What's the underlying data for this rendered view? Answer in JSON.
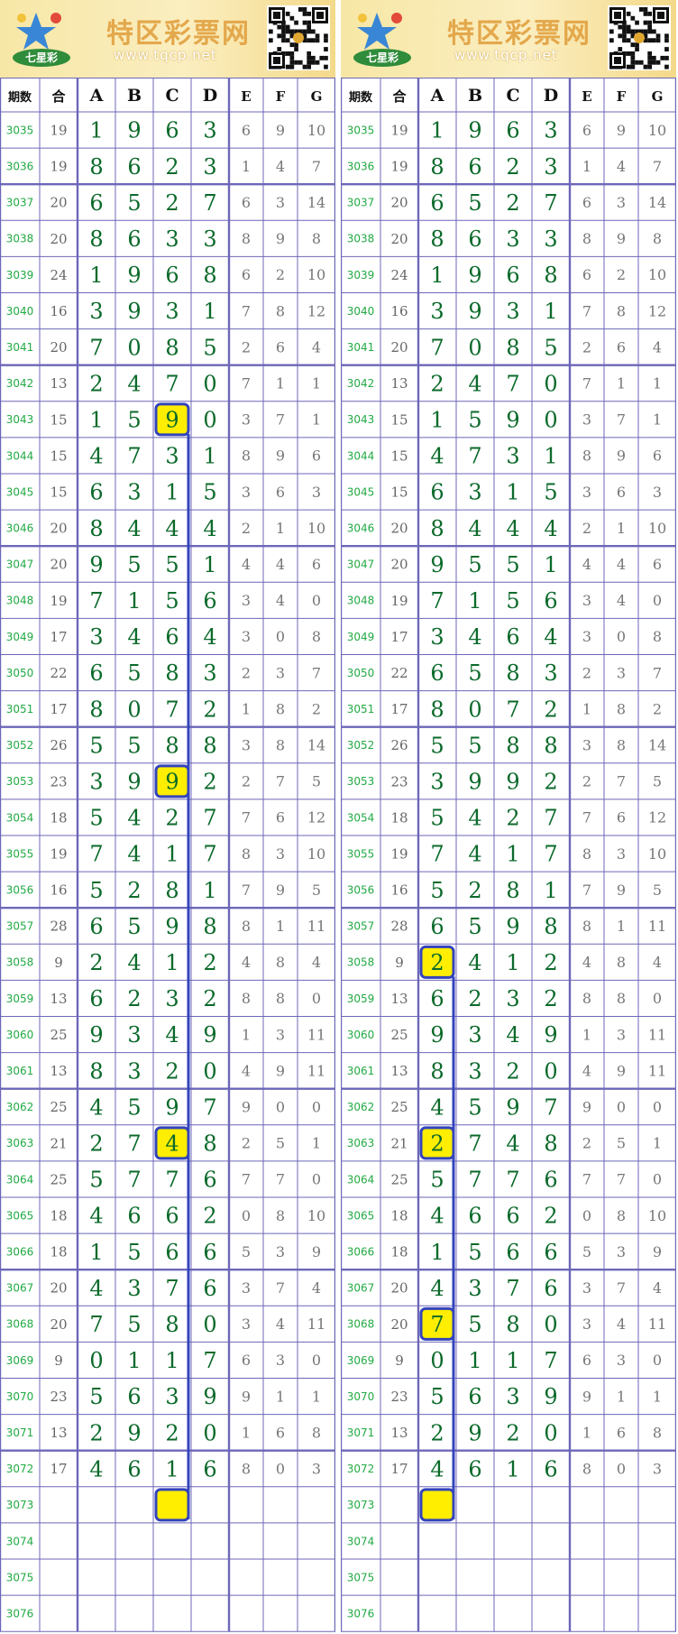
{
  "site": {
    "title": "特区彩票网",
    "url": "www.tqcp.net",
    "logo_text": "七星彩"
  },
  "columns": [
    "期数",
    "合",
    "A",
    "B",
    "C",
    "D",
    "E",
    "F",
    "G"
  ],
  "rows": [
    {
      "issue": "3035",
      "sum": "19",
      "a": "1",
      "b": "9",
      "c": "6",
      "d": "3",
      "e": "6",
      "f": "9",
      "g": "10"
    },
    {
      "issue": "3036",
      "sum": "19",
      "a": "8",
      "b": "6",
      "c": "2",
      "d": "3",
      "e": "1",
      "f": "4",
      "g": "7"
    },
    {
      "issue": "3037",
      "sum": "20",
      "a": "6",
      "b": "5",
      "c": "2",
      "d": "7",
      "e": "6",
      "f": "3",
      "g": "14"
    },
    {
      "issue": "3038",
      "sum": "20",
      "a": "8",
      "b": "6",
      "c": "3",
      "d": "3",
      "e": "8",
      "f": "9",
      "g": "8"
    },
    {
      "issue": "3039",
      "sum": "24",
      "a": "1",
      "b": "9",
      "c": "6",
      "d": "8",
      "e": "6",
      "f": "2",
      "g": "10"
    },
    {
      "issue": "3040",
      "sum": "16",
      "a": "3",
      "b": "9",
      "c": "3",
      "d": "1",
      "e": "7",
      "f": "8",
      "g": "12"
    },
    {
      "issue": "3041",
      "sum": "20",
      "a": "7",
      "b": "0",
      "c": "8",
      "d": "5",
      "e": "2",
      "f": "6",
      "g": "4"
    },
    {
      "issue": "3042",
      "sum": "13",
      "a": "2",
      "b": "4",
      "c": "7",
      "d": "0",
      "e": "7",
      "f": "1",
      "g": "1"
    },
    {
      "issue": "3043",
      "sum": "15",
      "a": "1",
      "b": "5",
      "c": "9",
      "d": "0",
      "e": "3",
      "f": "7",
      "g": "1"
    },
    {
      "issue": "3044",
      "sum": "15",
      "a": "4",
      "b": "7",
      "c": "3",
      "d": "1",
      "e": "8",
      "f": "9",
      "g": "6"
    },
    {
      "issue": "3045",
      "sum": "15",
      "a": "6",
      "b": "3",
      "c": "1",
      "d": "5",
      "e": "3",
      "f": "6",
      "g": "3"
    },
    {
      "issue": "3046",
      "sum": "20",
      "a": "8",
      "b": "4",
      "c": "4",
      "d": "4",
      "e": "2",
      "f": "1",
      "g": "10"
    },
    {
      "issue": "3047",
      "sum": "20",
      "a": "9",
      "b": "5",
      "c": "5",
      "d": "1",
      "e": "4",
      "f": "4",
      "g": "6"
    },
    {
      "issue": "3048",
      "sum": "19",
      "a": "7",
      "b": "1",
      "c": "5",
      "d": "6",
      "e": "3",
      "f": "4",
      "g": "0"
    },
    {
      "issue": "3049",
      "sum": "17",
      "a": "3",
      "b": "4",
      "c": "6",
      "d": "4",
      "e": "3",
      "f": "0",
      "g": "8"
    },
    {
      "issue": "3050",
      "sum": "22",
      "a": "6",
      "b": "5",
      "c": "8",
      "d": "3",
      "e": "2",
      "f": "3",
      "g": "7"
    },
    {
      "issue": "3051",
      "sum": "17",
      "a": "8",
      "b": "0",
      "c": "7",
      "d": "2",
      "e": "1",
      "f": "8",
      "g": "2"
    },
    {
      "issue": "3052",
      "sum": "26",
      "a": "5",
      "b": "5",
      "c": "8",
      "d": "8",
      "e": "3",
      "f": "8",
      "g": "14"
    },
    {
      "issue": "3053",
      "sum": "23",
      "a": "3",
      "b": "9",
      "c": "9",
      "d": "2",
      "e": "2",
      "f": "7",
      "g": "5"
    },
    {
      "issue": "3054",
      "sum": "18",
      "a": "5",
      "b": "4",
      "c": "2",
      "d": "7",
      "e": "7",
      "f": "6",
      "g": "12"
    },
    {
      "issue": "3055",
      "sum": "19",
      "a": "7",
      "b": "4",
      "c": "1",
      "d": "7",
      "e": "8",
      "f": "3",
      "g": "10"
    },
    {
      "issue": "3056",
      "sum": "16",
      "a": "5",
      "b": "2",
      "c": "8",
      "d": "1",
      "e": "7",
      "f": "9",
      "g": "5"
    },
    {
      "issue": "3057",
      "sum": "28",
      "a": "6",
      "b": "5",
      "c": "9",
      "d": "8",
      "e": "8",
      "f": "1",
      "g": "11"
    },
    {
      "issue": "3058",
      "sum": "9",
      "a": "2",
      "b": "4",
      "c": "1",
      "d": "2",
      "e": "4",
      "f": "8",
      "g": "4"
    },
    {
      "issue": "3059",
      "sum": "13",
      "a": "6",
      "b": "2",
      "c": "3",
      "d": "2",
      "e": "8",
      "f": "8",
      "g": "0"
    },
    {
      "issue": "3060",
      "sum": "25",
      "a": "9",
      "b": "3",
      "c": "4",
      "d": "9",
      "e": "1",
      "f": "3",
      "g": "11"
    },
    {
      "issue": "3061",
      "sum": "13",
      "a": "8",
      "b": "3",
      "c": "2",
      "d": "0",
      "e": "4",
      "f": "9",
      "g": "11"
    },
    {
      "issue": "3062",
      "sum": "25",
      "a": "4",
      "b": "5",
      "c": "9",
      "d": "7",
      "e": "9",
      "f": "0",
      "g": "0"
    },
    {
      "issue": "3063",
      "sum": "21",
      "a": "2",
      "b": "7",
      "c": "4",
      "d": "8",
      "e": "2",
      "f": "5",
      "g": "1"
    },
    {
      "issue": "3064",
      "sum": "25",
      "a": "5",
      "b": "7",
      "c": "7",
      "d": "6",
      "e": "7",
      "f": "7",
      "g": "0"
    },
    {
      "issue": "3065",
      "sum": "18",
      "a": "4",
      "b": "6",
      "c": "6",
      "d": "2",
      "e": "0",
      "f": "8",
      "g": "10"
    },
    {
      "issue": "3066",
      "sum": "18",
      "a": "1",
      "b": "5",
      "c": "6",
      "d": "6",
      "e": "5",
      "f": "3",
      "g": "9"
    },
    {
      "issue": "3067",
      "sum": "20",
      "a": "4",
      "b": "3",
      "c": "7",
      "d": "6",
      "e": "3",
      "f": "7",
      "g": "4"
    },
    {
      "issue": "3068",
      "sum": "20",
      "a": "7",
      "b": "5",
      "c": "8",
      "d": "0",
      "e": "3",
      "f": "4",
      "g": "11"
    },
    {
      "issue": "3069",
      "sum": "9",
      "a": "0",
      "b": "1",
      "c": "1",
      "d": "7",
      "e": "6",
      "f": "3",
      "g": "0"
    },
    {
      "issue": "3070",
      "sum": "23",
      "a": "5",
      "b": "6",
      "c": "3",
      "d": "9",
      "e": "9",
      "f": "1",
      "g": "1"
    },
    {
      "issue": "3071",
      "sum": "13",
      "a": "2",
      "b": "9",
      "c": "2",
      "d": "0",
      "e": "1",
      "f": "6",
      "g": "8"
    },
    {
      "issue": "3072",
      "sum": "17",
      "a": "4",
      "b": "6",
      "c": "1",
      "d": "6",
      "e": "8",
      "f": "0",
      "g": "3"
    },
    {
      "issue": "3073",
      "sum": "",
      "a": "",
      "b": "",
      "c": "",
      "d": "",
      "e": "",
      "f": "",
      "g": ""
    },
    {
      "issue": "3074",
      "sum": "",
      "a": "",
      "b": "",
      "c": "",
      "d": "",
      "e": "",
      "f": "",
      "g": ""
    },
    {
      "issue": "3075",
      "sum": "",
      "a": "",
      "b": "",
      "c": "",
      "d": "",
      "e": "",
      "f": "",
      "g": ""
    },
    {
      "issue": "3076",
      "sum": "",
      "a": "",
      "b": "",
      "c": "",
      "d": "",
      "e": "",
      "f": "",
      "g": ""
    }
  ],
  "panels": [
    {
      "id": "left",
      "highlight_col": "c",
      "highlights": [
        "3043",
        "3053",
        "3063",
        "3073"
      ]
    },
    {
      "id": "right",
      "highlight_col": "a",
      "highlights": [
        "3058",
        "3063",
        "3068",
        "3073"
      ]
    }
  ],
  "colors": {
    "issue": "#22aa44",
    "sum": "#666666",
    "main_digit": "#0b6a2a",
    "minor_digit": "#777777",
    "grid": "#6c67b8",
    "highlight_fill": "#ffee00",
    "highlight_border": "#3344bb",
    "header_text": "#111111",
    "trend_line": "#3344bb"
  }
}
